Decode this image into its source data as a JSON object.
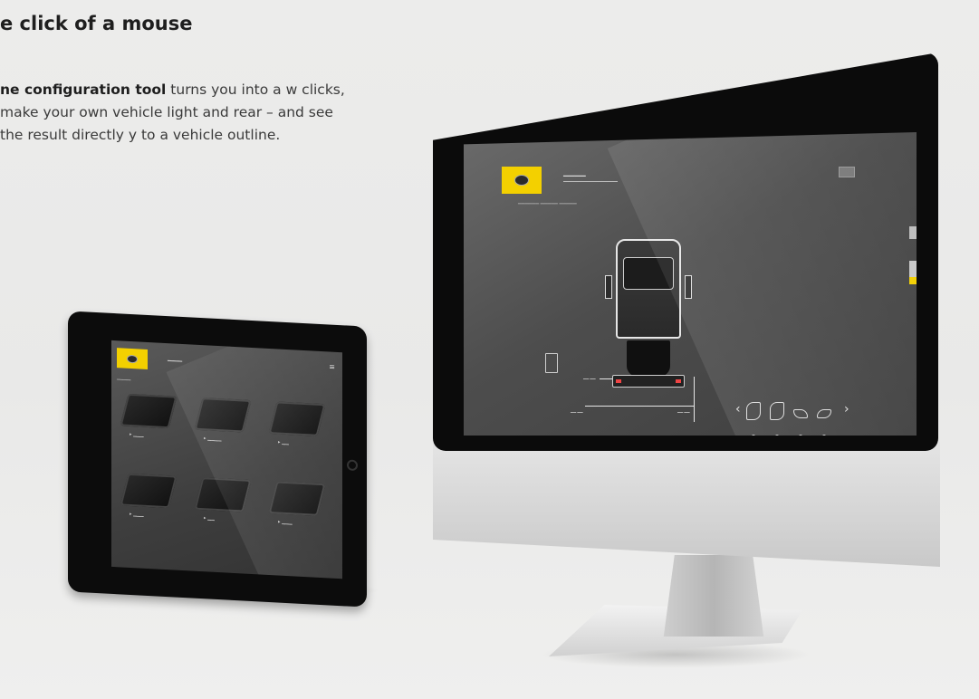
{
  "heading": "e click of a mouse",
  "body": {
    "lead": "ne configuration tool",
    "rest": " turns you into a w clicks, make your own vehicle light and rear – and see the result directly y to a vehicle outline."
  },
  "colors": {
    "brand_yellow": "#f3d000",
    "background": "#ececeb",
    "screen": "#4d4d4d"
  },
  "tablet": {
    "icons": [
      "hella-logo-icon",
      "menu-icon",
      "home-button-icon"
    ],
    "items": [
      {
        "name": "item-1"
      },
      {
        "name": "item-2"
      },
      {
        "name": "item-3"
      },
      {
        "name": "item-4"
      },
      {
        "name": "item-5"
      },
      {
        "name": "item-6"
      }
    ]
  },
  "monitor": {
    "icons": [
      "hella-logo-icon",
      "trash-bin-icon",
      "truck-outline-icon",
      "chevron-left-icon",
      "chevron-right-icon",
      "chevron-up-icon"
    ]
  }
}
